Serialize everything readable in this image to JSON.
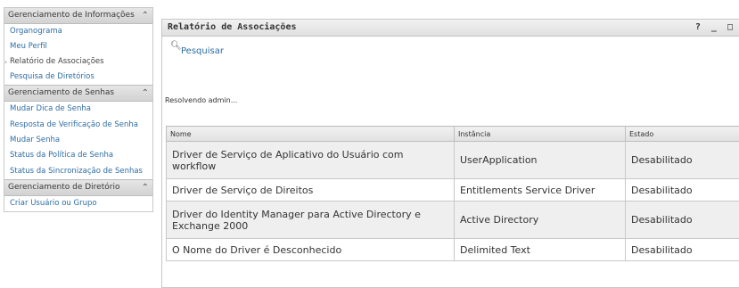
{
  "sidebar": {
    "sections": [
      {
        "title": "Gerenciamento de Informações",
        "collapse_icon": "chevron-up-icon",
        "items": [
          {
            "label": "Organograma",
            "active": false
          },
          {
            "label": "Meu Perfil",
            "active": false
          },
          {
            "label": "Relatório de Associações",
            "active": true
          },
          {
            "label": "Pesquisa de Diretórios",
            "active": false
          }
        ]
      },
      {
        "title": "Gerenciamento de Senhas",
        "collapse_icon": "chevron-up-icon",
        "items": [
          {
            "label": "Mudar Dica de Senha"
          },
          {
            "label": "Resposta de Verificação de Senha"
          },
          {
            "label": "Mudar Senha"
          },
          {
            "label": "Status da Política de Senha"
          },
          {
            "label": "Status da Sincronização de Senhas"
          }
        ]
      },
      {
        "title": "Gerenciamento de Diretório",
        "collapse_icon": "chevron-up-icon",
        "items": [
          {
            "label": "Criar Usuário ou Grupo"
          }
        ]
      }
    ]
  },
  "portlet": {
    "title": "Relatório de Associações",
    "controls": [
      "?",
      "_",
      "□"
    ],
    "search_label": "Pesquisar",
    "status": "Resolvendo admin...",
    "table": {
      "headers": [
        "Nome",
        "Instância",
        "Estado"
      ],
      "rows": [
        [
          "Driver de Serviço de Aplicativo do Usuário com workflow",
          "UserApplication",
          "Desabilitado"
        ],
        [
          "Driver de Serviço de Direitos",
          "Entitlements Service Driver",
          "Desabilitado"
        ],
        [
          "Driver do Identity Manager para Active Directory e Exchange 2000",
          "Active Directory",
          "Desabilitado"
        ],
        [
          "O Nome do Driver é Desconhecido",
          "Delimited Text",
          "Desabilitado"
        ]
      ]
    }
  },
  "colors": {
    "link": "#2e6da4",
    "header_bg": "#e0e0e0",
    "row_alt": "#efefef"
  }
}
